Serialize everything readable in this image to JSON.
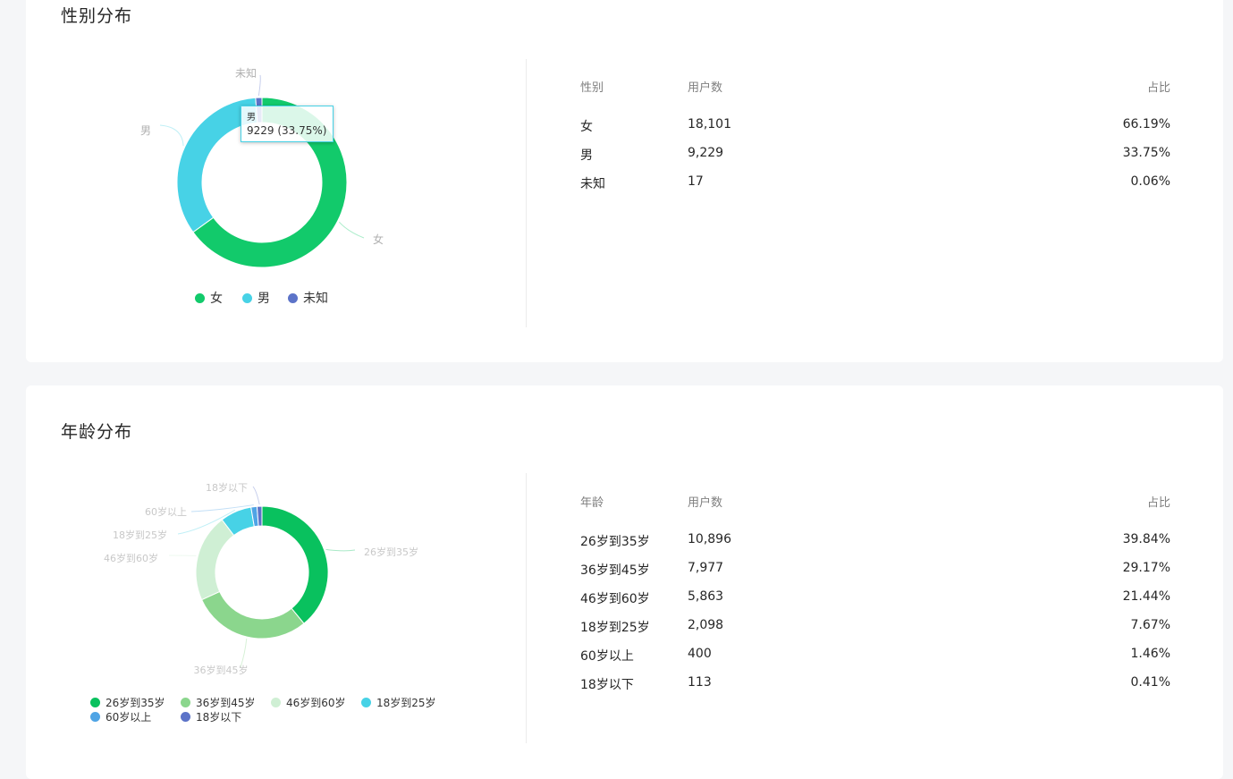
{
  "gender": {
    "title": "性别分布",
    "table_headers": [
      "性别",
      "用户数",
      "占比"
    ],
    "rows": [
      {
        "label": "女",
        "count": "18,101",
        "pct": "66.19%"
      },
      {
        "label": "男",
        "count": "9,229",
        "pct": "33.75%"
      },
      {
        "label": "未知",
        "count": "17",
        "pct": "0.06%"
      }
    ],
    "tooltip": {
      "name": "男",
      "value": "9229 (33.75%)"
    }
  },
  "age": {
    "title": "年龄分布",
    "table_headers": [
      "年龄",
      "用户数",
      "占比"
    ],
    "rows": [
      {
        "label": "26岁到35岁",
        "count": "10,896",
        "pct": "39.84%"
      },
      {
        "label": "36岁到45岁",
        "count": "7,977",
        "pct": "29.17%"
      },
      {
        "label": "46岁到60岁",
        "count": "5,863",
        "pct": "21.44%"
      },
      {
        "label": "18岁到25岁",
        "count": "2,098",
        "pct": "7.67%"
      },
      {
        "label": "60岁以上",
        "count": "400",
        "pct": "1.46%"
      },
      {
        "label": "18岁以下",
        "count": "113",
        "pct": "0.41%"
      }
    ]
  },
  "colors": {
    "female": "#12ca6b",
    "male": "#47d2e6",
    "unknown": "#5c73c8",
    "age_26_35": "#09c15e",
    "age_36_45": "#8bd68d",
    "age_46_60": "#cfefd4",
    "age_18_25": "#47d2e6",
    "age_60_plus": "#4fa4e5",
    "age_under_18": "#5c73c8"
  },
  "chart_data": [
    {
      "type": "pie",
      "title": "性别分布",
      "categories": [
        "女",
        "男",
        "未知"
      ],
      "values": [
        18101,
        9229,
        17
      ],
      "percentages": [
        66.19,
        33.75,
        0.06
      ],
      "legend": [
        "女",
        "男",
        "未知"
      ],
      "legend_position": "bottom",
      "highlighted": "男"
    },
    {
      "type": "pie",
      "title": "年龄分布",
      "categories": [
        "26岁到35岁",
        "36岁到45岁",
        "46岁到60岁",
        "18岁到25岁",
        "60岁以上",
        "18岁以下"
      ],
      "values": [
        10896,
        7977,
        5863,
        2098,
        400,
        113
      ],
      "percentages": [
        39.84,
        29.17,
        21.44,
        7.67,
        1.46,
        0.41
      ],
      "legend": [
        "26岁到35岁",
        "36岁到45岁",
        "46岁到60岁",
        "18岁到25岁",
        "60岁以上",
        "18岁以下"
      ],
      "legend_position": "bottom"
    }
  ]
}
